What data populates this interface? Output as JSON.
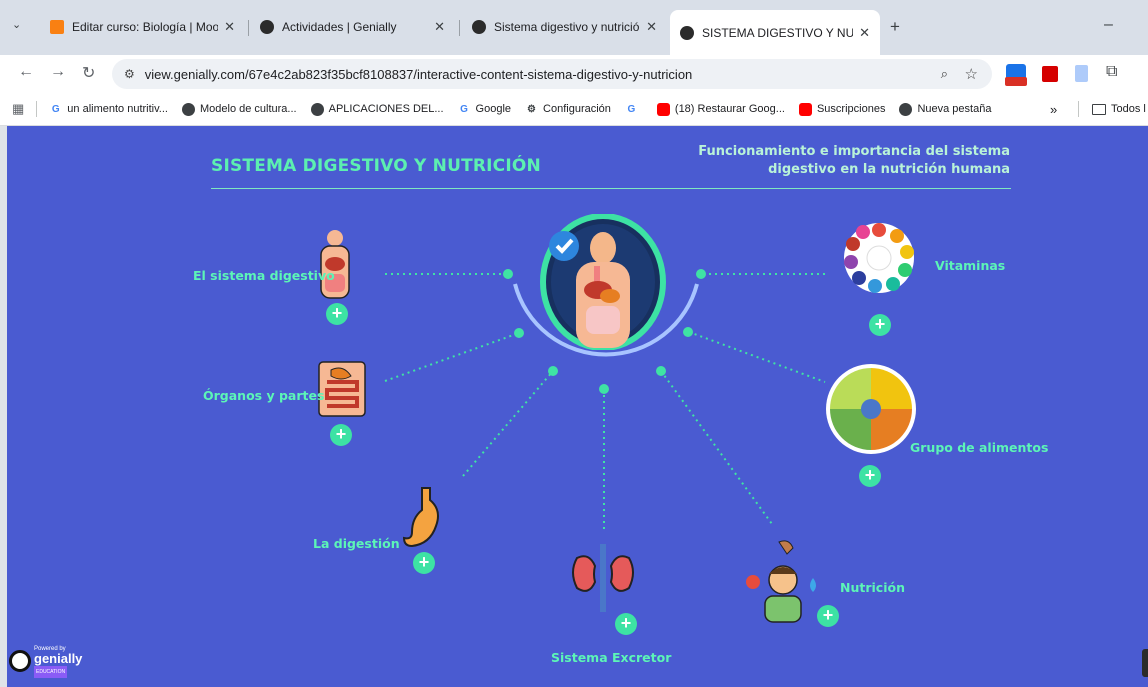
{
  "browser": {
    "tabs": [
      {
        "title": "Editar curso: Biología | Moodle",
        "favicon_color": "#f98012",
        "active": false
      },
      {
        "title": "Actividades | Genially",
        "favicon_color": "#2b2b2b",
        "active": false
      },
      {
        "title": "Sistema digestivo y nutrición | C",
        "favicon_color": "#2b2b2b",
        "active": false
      },
      {
        "title": "SISTEMA DIGESTIVO Y NUTRICI",
        "favicon_color": "#2b2b2b",
        "active": true
      }
    ],
    "new_tab": "+",
    "minimize": "–",
    "url": "view.genially.com/67e4c2ab823f35bcf8108837/interactive-content-sistema-digestivo-y-nutricion",
    "bookmarks": [
      {
        "label": "un alimento nutritiv...",
        "icon": "google-icon"
      },
      {
        "label": "Modelo de cultura...",
        "icon": "globe-icon"
      },
      {
        "label": "APLICACIONES DEL...",
        "icon": "globe-icon"
      },
      {
        "label": "Google",
        "icon": "google-icon"
      },
      {
        "label": "Configuración",
        "icon": "gear-icon"
      },
      {
        "label": "",
        "icon": "google-icon"
      },
      {
        "label": "(18) Restaurar Goog...",
        "icon": "youtube-icon"
      },
      {
        "label": "Suscripciones",
        "icon": "youtube-icon"
      },
      {
        "label": "Nueva pestaña",
        "icon": "globe-icon"
      }
    ],
    "more_bookmarks": "»",
    "all_bookmarks": "Todos l"
  },
  "presentation": {
    "title": "SISTEMA DIGESTIVO Y NUTRICIÓN",
    "subtitle_line1": "Funcionamiento e importancia del sistema",
    "subtitle_line2": "digestivo en la nutrición humana",
    "topics": {
      "sistema_digestivo": "El sistema digestivo",
      "organos": "Órganos y partes",
      "digestion": "La digestión",
      "excretor": "Sistema Excretor",
      "nutricion": "Nutrición",
      "alimentos": "Grupo de alimentos",
      "vitaminas": "Vitaminas"
    },
    "plus_symbol": "+",
    "logo_small": "Powered by",
    "logo_name": "genially",
    "logo_tag": "EDUCATION",
    "colors": {
      "background": "#4a5bd1",
      "accent": "#3de2a4",
      "title": "#5cf0b0"
    }
  }
}
